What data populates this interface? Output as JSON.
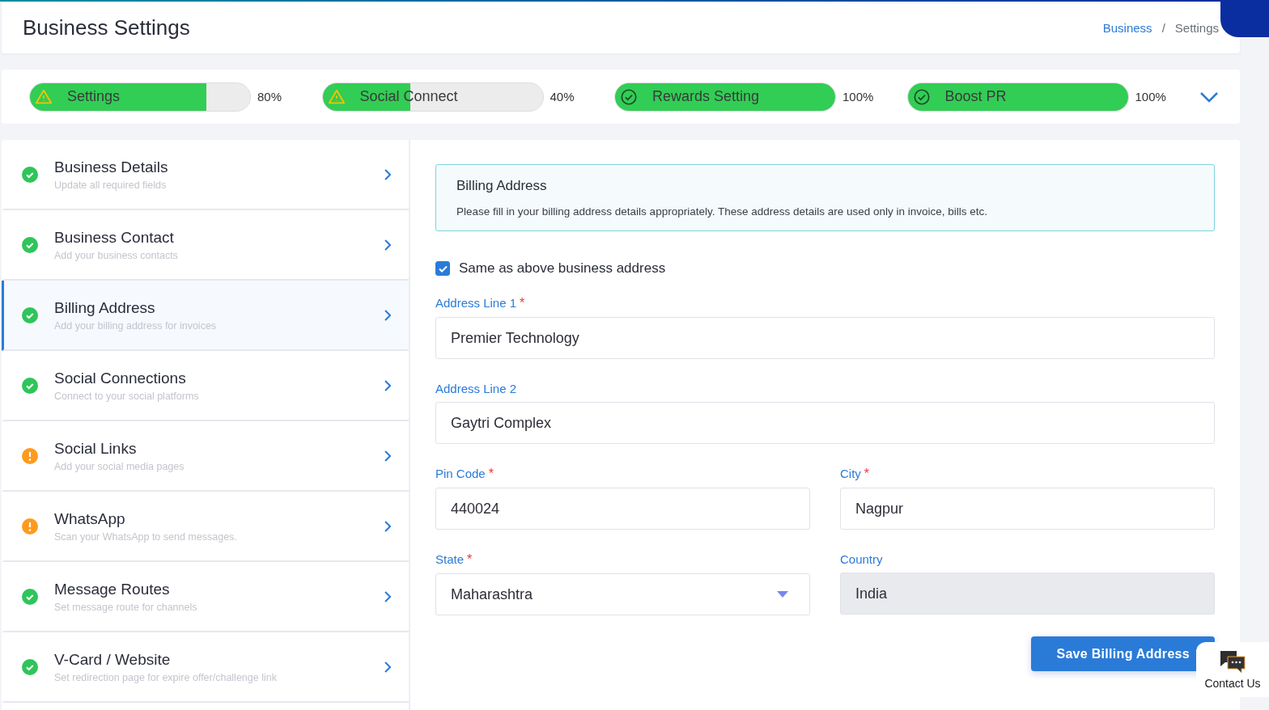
{
  "header": {
    "title": "Business Settings",
    "breadcrumb": [
      {
        "label": "Business",
        "kind": "link"
      },
      {
        "label": "/",
        "kind": "separator"
      },
      {
        "label": "Settings",
        "kind": "current"
      }
    ]
  },
  "progress": [
    {
      "label": "Settings",
      "kind": "warning",
      "level": 0.8,
      "reading": "80%"
    },
    {
      "label": "Social Connect",
      "kind": "warning",
      "level": 0.4,
      "reading": "40%"
    },
    {
      "label": "Rewards Setting",
      "kind": "done",
      "level": 1,
      "reading": "100%"
    },
    {
      "label": "Boost PR",
      "kind": "done",
      "level": 1,
      "reading": "100%"
    }
  ],
  "steps": [
    {
      "title": "Business Details",
      "subtitle": "Update all required fields",
      "kind": "done",
      "selected": false
    },
    {
      "title": "Business Contact",
      "subtitle": "Add your business contacts",
      "kind": "done",
      "selected": false
    },
    {
      "title": "Billing Address",
      "subtitle": "Add your billing address for invoices",
      "kind": "done",
      "selected": true
    },
    {
      "title": "Social Connections",
      "subtitle": "Connect to your social platforms",
      "kind": "done",
      "selected": false
    },
    {
      "title": "Social Links",
      "subtitle": "Add your social media pages",
      "kind": "pending",
      "selected": false
    },
    {
      "title": "WhatsApp",
      "subtitle": "Scan your WhatsApp to send messages.",
      "kind": "pending",
      "selected": false
    },
    {
      "title": "Message Routes",
      "subtitle": "Set message route for channels",
      "kind": "done",
      "selected": false
    },
    {
      "title": "V-Card / Website",
      "subtitle": "Set redirection page for expire offer/challenge link",
      "kind": "done",
      "selected": false
    }
  ],
  "form": {
    "notice": {
      "title": "Billing Address",
      "text": "Please fill in your billing address details appropriately. These address details are used only in invoice, bills etc."
    },
    "same_as_above": {
      "label": "Same as above business address",
      "checked": true
    },
    "rows": [
      [
        {
          "label": "Address Line 1",
          "required_mark": "*",
          "kind": "text",
          "value": "Premier Technology"
        }
      ],
      [
        {
          "label": "Address Line 2",
          "kind": "text",
          "value": "Gaytri Complex"
        }
      ],
      [
        {
          "label": "Pin Code",
          "required_mark": "*",
          "kind": "text",
          "value": "440024"
        },
        {
          "label": "City",
          "required_mark": "*",
          "kind": "text",
          "value": "Nagpur"
        }
      ],
      [
        {
          "label": "State",
          "required_mark": "*",
          "kind": "select",
          "value": "Maharashtra"
        },
        {
          "label": "Country",
          "kind": "readonly",
          "value": "India"
        }
      ]
    ],
    "save_button": "Save Billing Address"
  },
  "contact": {
    "label": "Contact Us"
  }
}
